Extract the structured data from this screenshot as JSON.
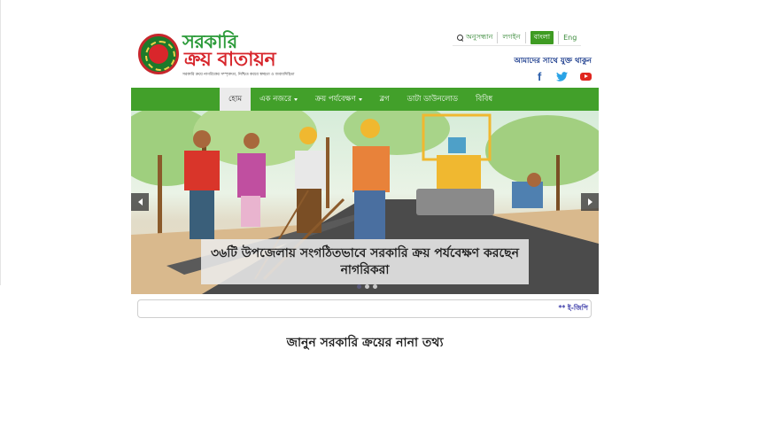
{
  "header": {
    "logo_line1": "সরকারি",
    "logo_line2": "ক্রয় বাতায়ন",
    "logo_tagline": "সরকারি ক্রয়ে নাগরিকের সম্পৃক্ততা, নিশ্চিত করবে স্বচ্ছতা ও জবাবদিহিতা",
    "topbar": {
      "search_label": "অনুসন্ধান",
      "login_label": "লগইন",
      "lang_bn": "বাংলা",
      "lang_en": "Eng"
    },
    "connect_text": "আমাদের সাথে যুক্ত থাকুন",
    "social": [
      "facebook",
      "twitter",
      "youtube"
    ]
  },
  "nav": {
    "items": [
      {
        "label": "হোম",
        "active": true,
        "dropdown": false
      },
      {
        "label": "এক নজরে",
        "active": false,
        "dropdown": true
      },
      {
        "label": "ক্রয় পর্যবেক্ষণ",
        "active": false,
        "dropdown": true
      },
      {
        "label": "ব্লগ",
        "active": false,
        "dropdown": false
      },
      {
        "label": "ডাটা ডাউনলোড",
        "active": false,
        "dropdown": false
      },
      {
        "label": "বিবিধ",
        "active": false,
        "dropdown": false
      }
    ]
  },
  "slider": {
    "caption": "৩৬টি উপজেলায় সংগঠিতভাবে সরকারি ক্রয় পর্যবেক্ষণ করছেন নাগরিকরা",
    "dot_count": 3,
    "active_dot": 0
  },
  "ticker": {
    "text": "** ই-জিপি"
  },
  "section": {
    "title": "জানুন সরকারি ক্রয়ের নানা তথ্য"
  },
  "colors": {
    "brand_green": "#42a02a",
    "brand_red": "#d7262c",
    "link_blue": "#1f3f8f"
  }
}
